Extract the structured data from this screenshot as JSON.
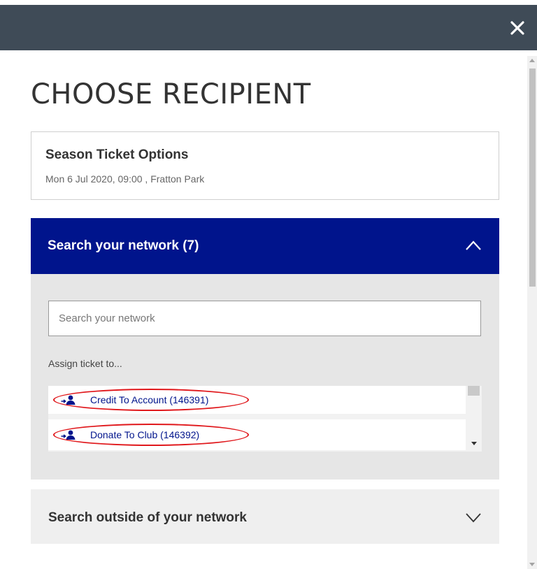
{
  "modal": {
    "title": "CHOOSE RECIPIENT",
    "close_icon": "close-icon"
  },
  "event": {
    "name": "Season Ticket Options",
    "details": "Mon 6 Jul 2020, 09:00 , Fratton Park"
  },
  "network": {
    "header": "Search your network (7)",
    "expanded": true,
    "search_placeholder": "Search your network",
    "assign_label": "Assign ticket to...",
    "items": [
      {
        "label": "Credit To Account (146391)",
        "icon": "person-arrow-icon"
      },
      {
        "label": "Donate To Club (146392)",
        "icon": "person-arrow-icon"
      }
    ]
  },
  "outside": {
    "header": "Search outside of your network",
    "expanded": false
  },
  "colors": {
    "topbar": "#3f4b57",
    "accent": "#00148c",
    "highlight": "#e0181c"
  }
}
